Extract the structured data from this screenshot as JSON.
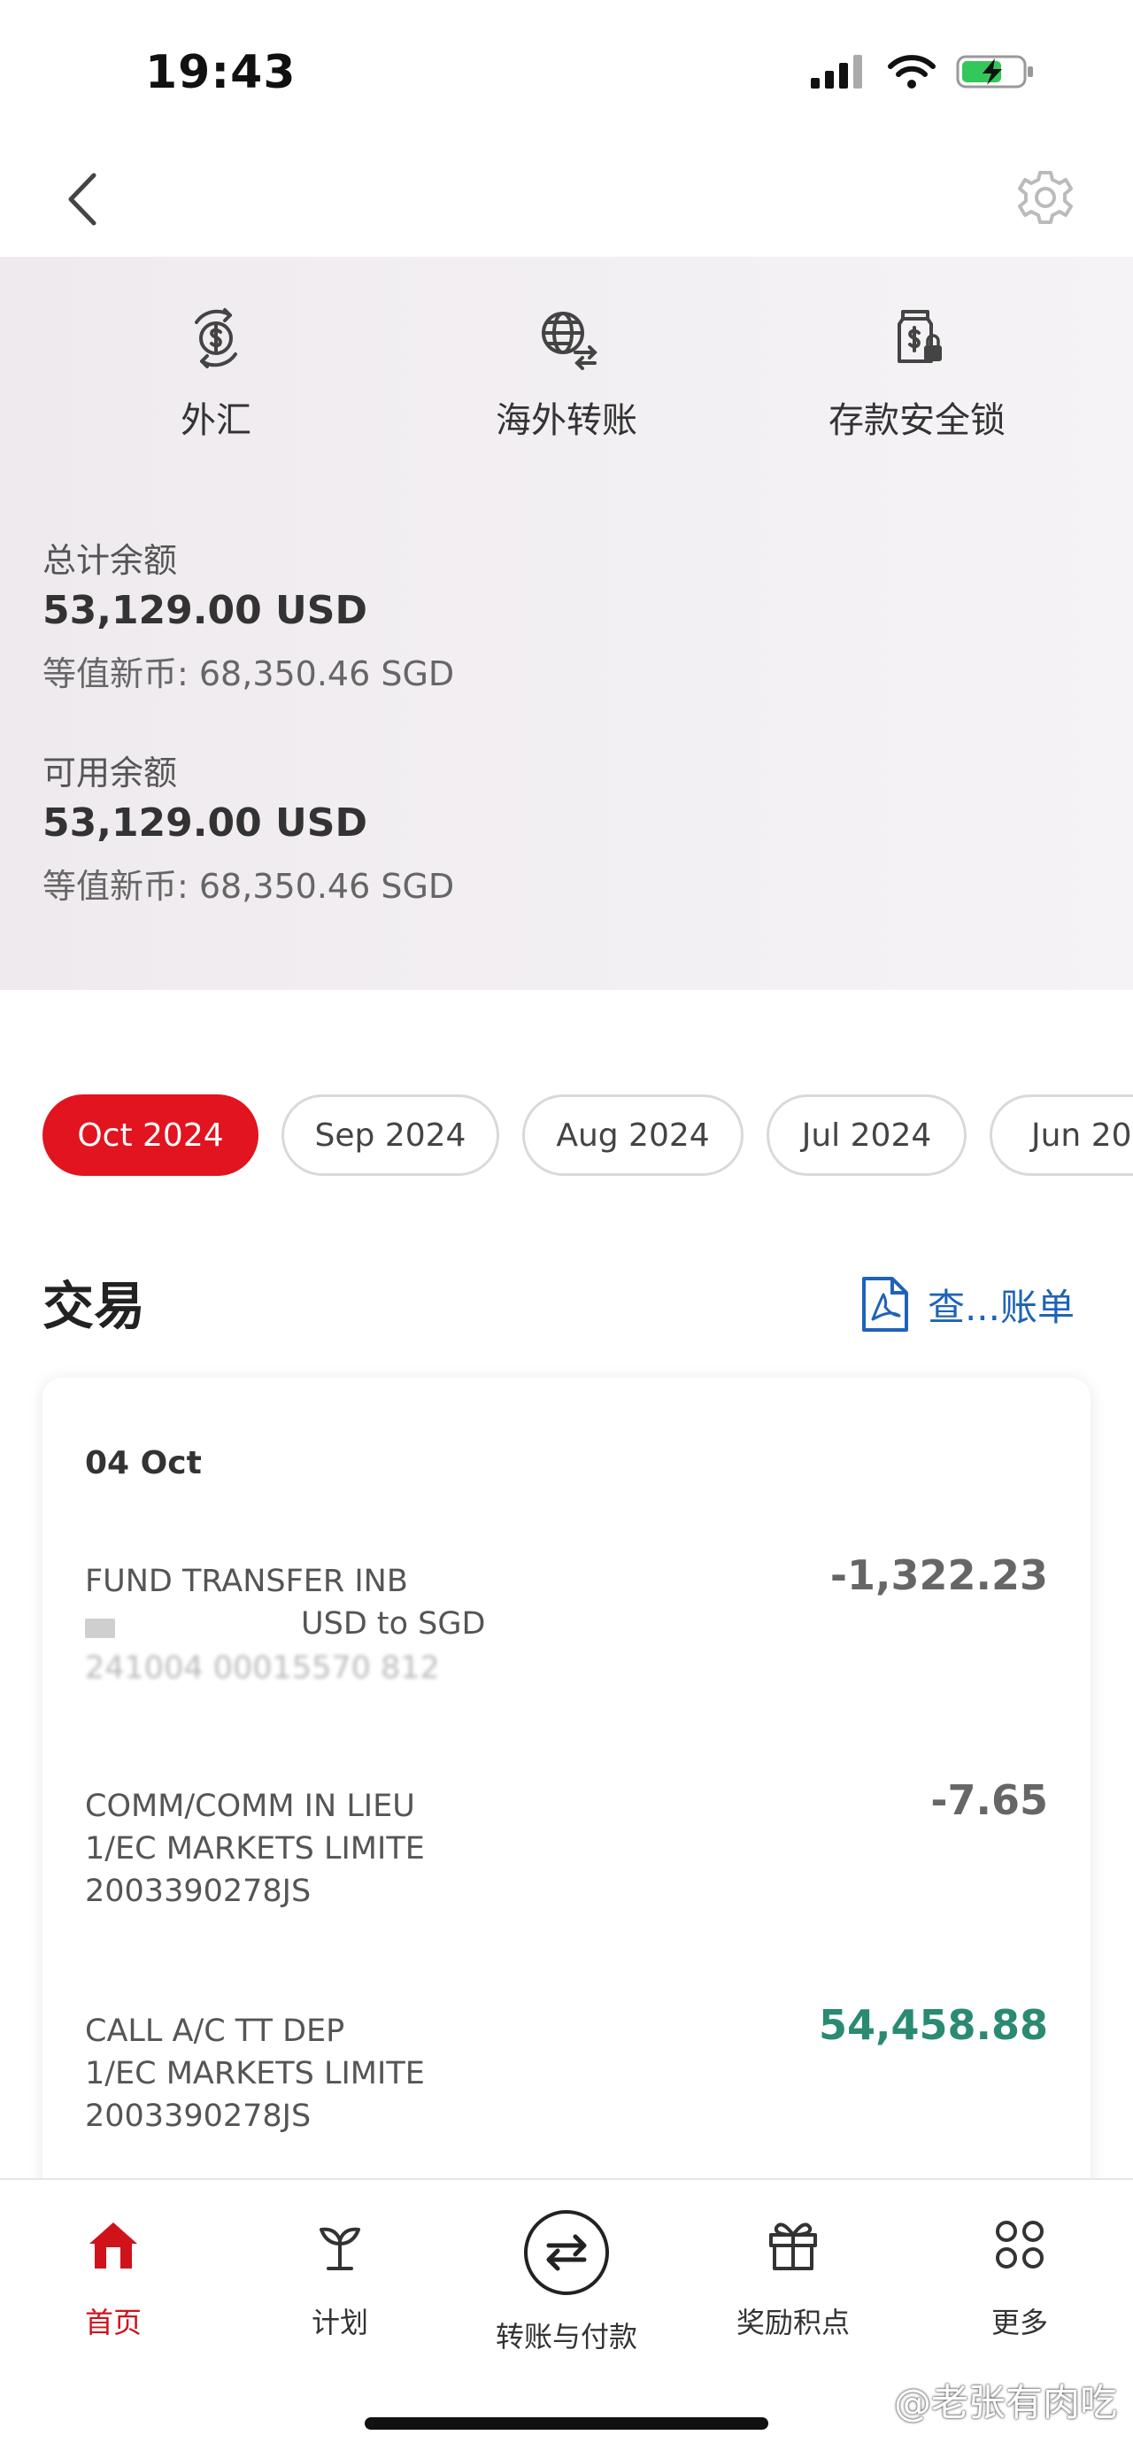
{
  "status_bar": {
    "time": "19:43"
  },
  "quick_actions": [
    {
      "label": "外汇",
      "icon": "fx-exchange-icon"
    },
    {
      "label": "海外转账",
      "icon": "global-transfer-icon"
    },
    {
      "label": "存款安全锁",
      "icon": "deposit-lock-icon"
    }
  ],
  "balances": {
    "total_label": "总计余额",
    "total_value": "53,129.00 USD",
    "total_equiv": "等值新币: 68,350.46 SGD",
    "available_label": "可用余额",
    "available_value": "53,129.00 USD",
    "available_equiv": "等值新币: 68,350.46 SGD"
  },
  "months": [
    "Oct 2024",
    "Sep 2024",
    "Aug 2024",
    "Jul 2024",
    "Jun 202"
  ],
  "selected_month": "Oct 2024",
  "transactions": {
    "title": "交易",
    "statement_link": "查...账单",
    "date": "04 Oct",
    "items": [
      {
        "line1": "FUND TRANSFER INB",
        "line2": "USD to SGD",
        "line3": "241004 00015570 812",
        "amount": "-1,322.23"
      },
      {
        "line1": "COMM/COMM IN LIEU",
        "line2": "1/EC MARKETS LIMITE",
        "line3": "2003390278JS",
        "amount": "-7.65"
      },
      {
        "line1": "CALL A/C TT DEP",
        "line2": "1/EC MARKETS LIMITE",
        "line3": "2003390278JS",
        "amount": "54,458.88"
      }
    ]
  },
  "bottom_nav": [
    {
      "label": "首页",
      "icon": "home-icon"
    },
    {
      "label": "计划",
      "icon": "sprout-icon"
    },
    {
      "label": "转账与付款",
      "icon": "transfer-arrows-icon"
    },
    {
      "label": "奖励积点",
      "icon": "gift-icon"
    },
    {
      "label": "更多",
      "icon": "more-grid-icon"
    }
  ],
  "watermark": "@老张有肉吃",
  "colors": {
    "accent": "#e1141f",
    "positive": "#2a8a72",
    "link": "#1e63b8"
  }
}
